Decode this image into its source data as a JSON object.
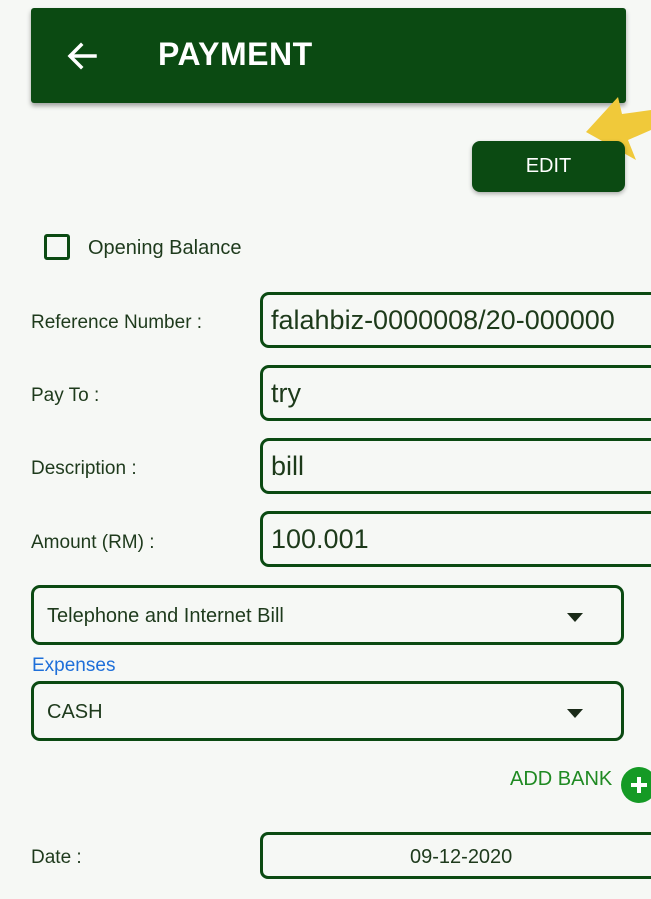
{
  "header": {
    "title": "PAYMENT",
    "back_icon": "arrow-left-icon",
    "color": "#0b4a12"
  },
  "annotation": {
    "icon": "arrow-pointer-icon",
    "color": "#f0c93a"
  },
  "toolbar": {
    "edit_label": "EDIT"
  },
  "opening_balance": {
    "label": "Opening Balance",
    "checked": false
  },
  "fields": {
    "reference": {
      "label": "Reference Number :",
      "value": "falahbiz-0000008/20-000000"
    },
    "pay_to": {
      "label": "Pay To :",
      "value": "try"
    },
    "description": {
      "label": "Description :",
      "value": "bill"
    },
    "amount": {
      "label": "Amount (RM) :",
      "value": "100.001"
    }
  },
  "category": {
    "selected": "Telephone and Internet Bill",
    "caption": "Expenses"
  },
  "payment_method": {
    "selected": "CASH"
  },
  "add_bank": {
    "label": "ADD BANK",
    "icon": "plus-circle-icon",
    "color": "#159a25"
  },
  "date": {
    "label": "Date :",
    "value": "09-12-2020"
  },
  "colors": {
    "primary": "#0b4a12",
    "link": "#1e6fd9",
    "accent": "#159a25"
  }
}
